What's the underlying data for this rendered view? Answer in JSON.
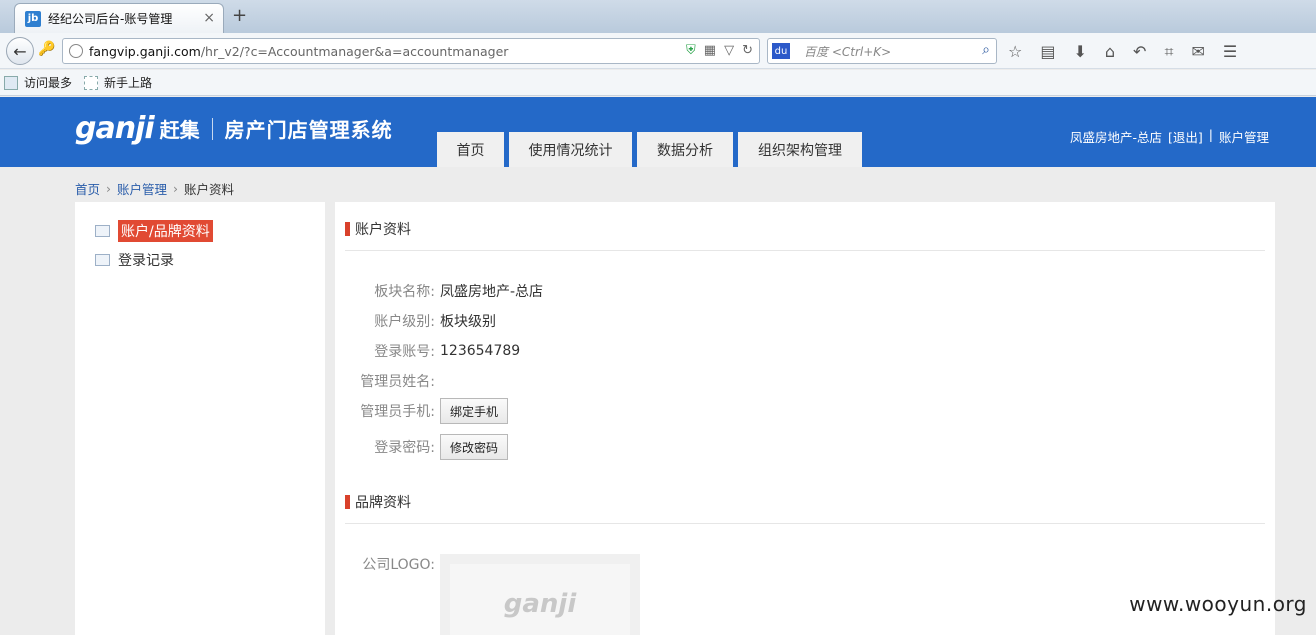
{
  "browser": {
    "tab_title": "经纪公司后台-账号管理",
    "favicon_text": "jb",
    "new_tab": "+",
    "url_host": "fangvip.ganji.com",
    "url_path": "/hr_v2/?c=Accountmanager&a=accountmanager",
    "search_placeholder": "百度 <Ctrl+K>",
    "bookmarks": [
      "访问最多",
      "新手上路"
    ]
  },
  "header": {
    "logo_mark": "ganji",
    "logo_cn": "赶集",
    "system_name": "房产门店管理系统",
    "nav": [
      "首页",
      "使用情况统计",
      "数据分析",
      "组织架构管理"
    ],
    "user_name": "凤盛房地产-总店",
    "logout": "[退出]",
    "divider": "|",
    "account_link": "账户管理"
  },
  "breadcrumb": [
    "首页",
    "账户管理",
    "账户资料"
  ],
  "sidebar": {
    "items": [
      {
        "label": "账户/品牌资料",
        "active": true
      },
      {
        "label": "登录记录",
        "active": false
      }
    ]
  },
  "account_section": {
    "title": "账户资料",
    "rows": [
      {
        "label": "板块名称:",
        "value": "凤盛房地产-总店"
      },
      {
        "label": "账户级别:",
        "value": "板块级别"
      },
      {
        "label": "登录账号:",
        "value": "123654789"
      },
      {
        "label": "管理员姓名:",
        "value": ""
      },
      {
        "label": "管理员手机:",
        "button": "绑定手机"
      },
      {
        "label": "登录密码:",
        "button": "修改密码"
      }
    ]
  },
  "brand_section": {
    "title": "品牌资料",
    "logo_label": "公司LOGO:",
    "logo_placeholder": "ganji"
  },
  "watermark": "www.wooyun.org"
}
